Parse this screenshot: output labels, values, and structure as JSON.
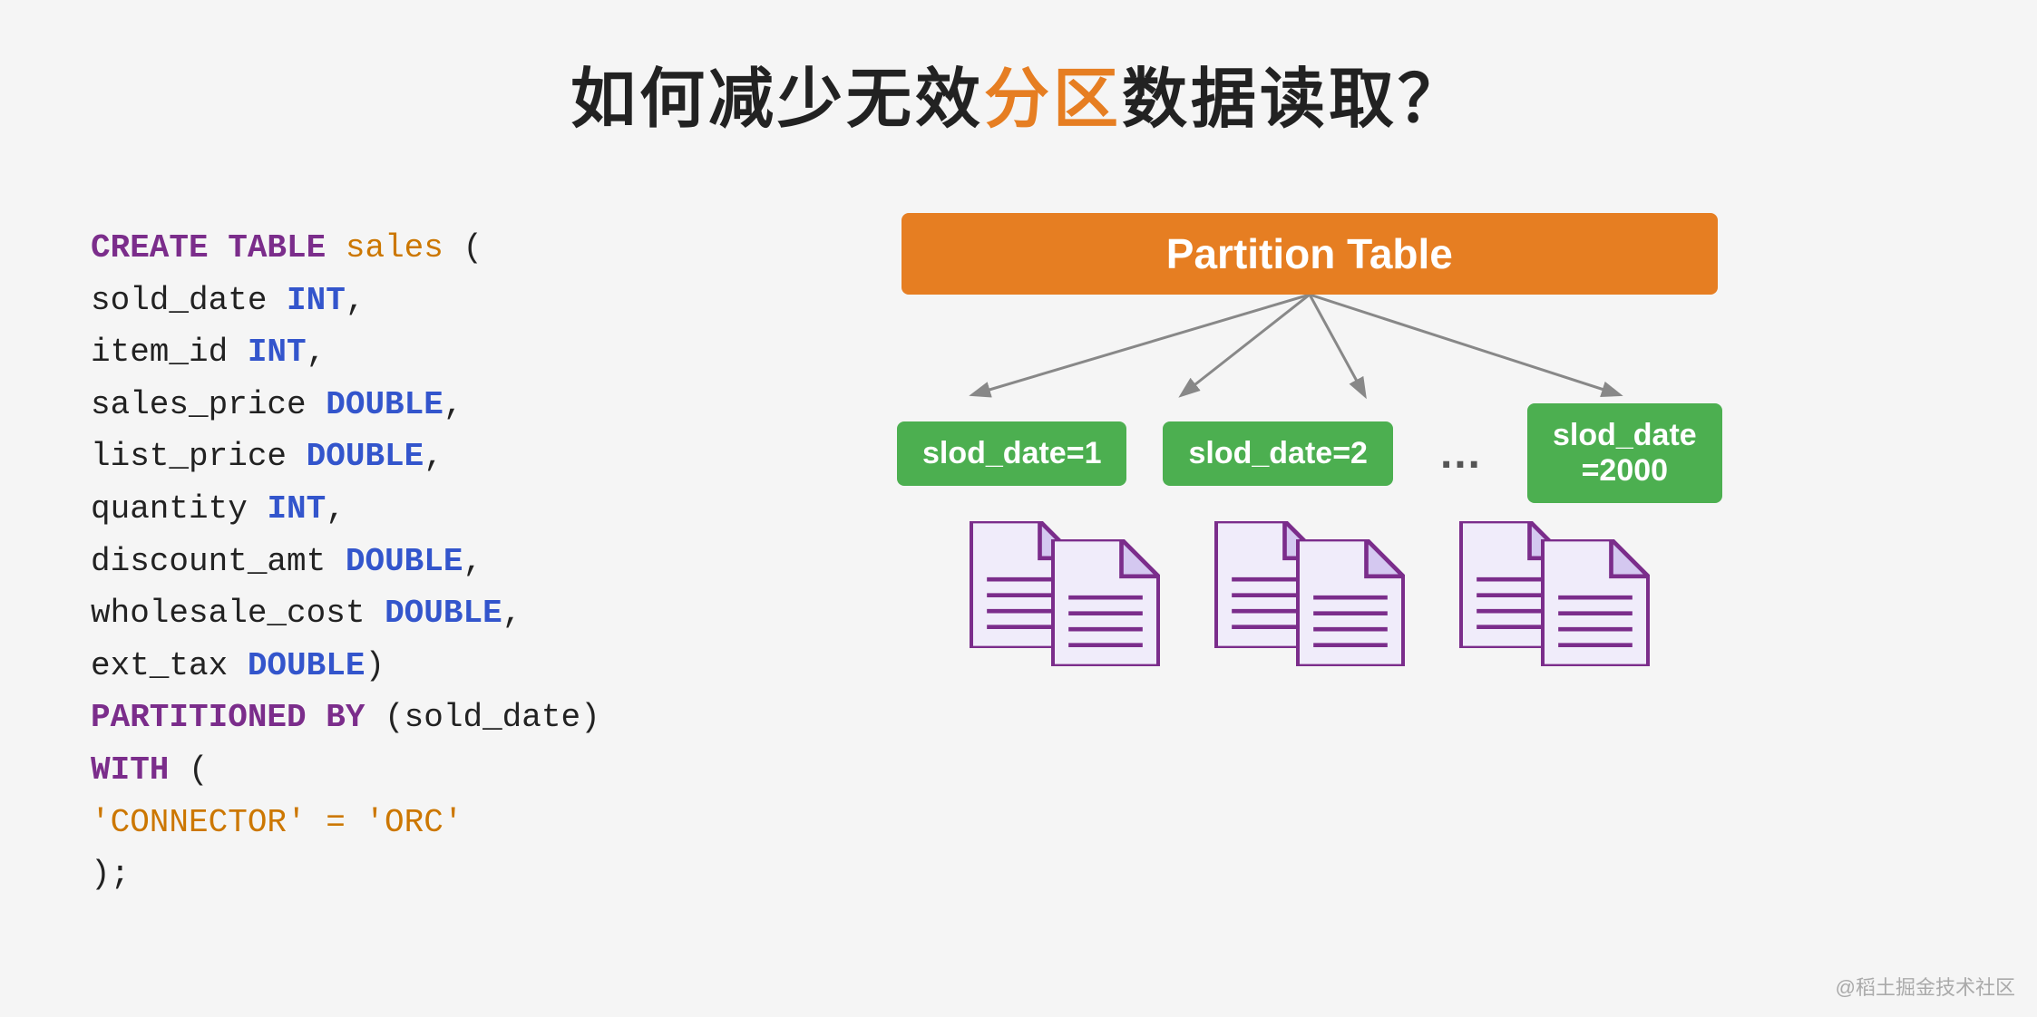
{
  "title": {
    "prefix": "如何减少无效",
    "highlight": "分区",
    "suffix": "数据读取？"
  },
  "code": {
    "lines": [
      {
        "text": "CREATE TABLE sales (",
        "parts": [
          {
            "t": "CREATE TABLE ",
            "cls": "kw-create"
          },
          {
            "t": "sales",
            "cls": "kw-string"
          },
          {
            "t": " (",
            "cls": ""
          }
        ]
      },
      {
        "text": "  sold_date          INT,",
        "parts": [
          {
            "t": "  sold_date          ",
            "cls": ""
          },
          {
            "t": "INT",
            "cls": "kw-type"
          },
          {
            "t": ",",
            "cls": ""
          }
        ]
      },
      {
        "text": "  item_id            INT,",
        "parts": [
          {
            "t": "  item_id            ",
            "cls": ""
          },
          {
            "t": "INT",
            "cls": "kw-type"
          },
          {
            "t": ",",
            "cls": ""
          }
        ]
      },
      {
        "text": "  sales_price        DOUBLE,",
        "parts": [
          {
            "t": "  sales_price        ",
            "cls": ""
          },
          {
            "t": "DOUBLE",
            "cls": "kw-type"
          },
          {
            "t": ",",
            "cls": ""
          }
        ]
      },
      {
        "text": "  list_price         DOUBLE,",
        "parts": [
          {
            "t": "  list_price         ",
            "cls": ""
          },
          {
            "t": "DOUBLE",
            "cls": "kw-type"
          },
          {
            "t": ",",
            "cls": ""
          }
        ]
      },
      {
        "text": "  quantity           INT,",
        "parts": [
          {
            "t": "  quantity           ",
            "cls": ""
          },
          {
            "t": "INT",
            "cls": "kw-type"
          },
          {
            "t": ",",
            "cls": ""
          }
        ]
      },
      {
        "text": "  discount_amt       DOUBLE,",
        "parts": [
          {
            "t": "  discount_amt       ",
            "cls": ""
          },
          {
            "t": "DOUBLE",
            "cls": "kw-type"
          },
          {
            "t": ",",
            "cls": ""
          }
        ]
      },
      {
        "text": "  wholesale_cost     DOUBLE,",
        "parts": [
          {
            "t": "  wholesale_cost     ",
            "cls": ""
          },
          {
            "t": "DOUBLE",
            "cls": "kw-type"
          },
          {
            "t": ",",
            "cls": ""
          }
        ]
      },
      {
        "text": "  ext_tax            DOUBLE)",
        "parts": [
          {
            "t": "  ext_tax            ",
            "cls": ""
          },
          {
            "t": "DOUBLE",
            "cls": "kw-type"
          },
          {
            "t": ")",
            "cls": ""
          }
        ]
      },
      {
        "text": "PARTITIONED BY (sold_date)",
        "parts": [
          {
            "t": "PARTITIONED BY",
            "cls": "kw-part"
          },
          {
            "t": " (sold_date)",
            "cls": ""
          }
        ]
      },
      {
        "text": "WITH (",
        "parts": [
          {
            "t": "WITH",
            "cls": "kw-part"
          },
          {
            "t": " (",
            "cls": ""
          }
        ]
      },
      {
        "text": "  'CONNECTOR' = 'ORC'",
        "parts": [
          {
            "t": "  ",
            "cls": ""
          },
          {
            "t": "'CONNECTOR' = 'ORC'",
            "cls": "kw-string"
          }
        ]
      },
      {
        "text": ");",
        "parts": [
          {
            "t": ");",
            "cls": ""
          }
        ]
      }
    ]
  },
  "diagram": {
    "partition_table_label": "Partition Table",
    "partitions": [
      {
        "label": "slod_date=1"
      },
      {
        "label": "slod_date=2"
      },
      {
        "label": "..."
      },
      {
        "label": "slod_date\n=2000"
      }
    ],
    "file_groups": [
      {
        "count": 2
      },
      {
        "count": 2
      },
      {
        "count": 2
      }
    ]
  },
  "watermark": "@稻土掘金技术社区"
}
